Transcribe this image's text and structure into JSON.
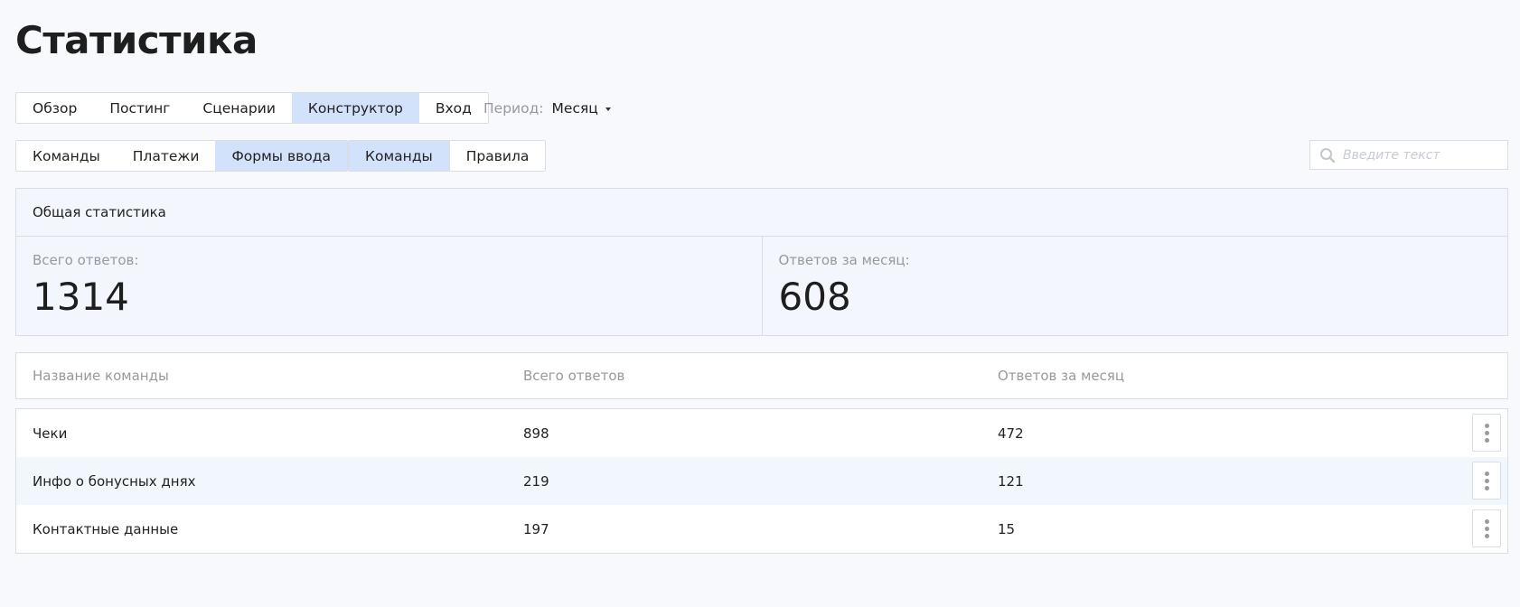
{
  "page": {
    "title": "Статистика"
  },
  "main_tabs": [
    {
      "label": "Обзор",
      "active": false
    },
    {
      "label": "Постинг",
      "active": false
    },
    {
      "label": "Сценарии",
      "active": false
    },
    {
      "label": "Конструктор",
      "active": true
    },
    {
      "label": "Вход",
      "active": false
    }
  ],
  "period": {
    "label": "Период:",
    "value": "Месяц"
  },
  "sub_tabs_1": [
    {
      "label": "Команды",
      "active": false
    },
    {
      "label": "Платежи",
      "active": false
    },
    {
      "label": "Формы ввода",
      "active": true
    }
  ],
  "sub_tabs_2": [
    {
      "label": "Команды",
      "active": true
    },
    {
      "label": "Правила",
      "active": false
    }
  ],
  "search": {
    "placeholder": "Введите текст",
    "value": ""
  },
  "stats": {
    "header": "Общая статистика",
    "total_label": "Всего ответов:",
    "total_value": "1314",
    "month_label": "Ответов за месяц:",
    "month_value": "608"
  },
  "table": {
    "columns": [
      "Название команды",
      "Всего ответов",
      "Ответов за месяц"
    ],
    "rows": [
      [
        "Чеки",
        "898",
        "472"
      ],
      [
        "Инфо о бонусных днях",
        "219",
        "121"
      ],
      [
        "Контактные данные",
        "197",
        "15"
      ]
    ]
  },
  "colors": {
    "background": "#f7f9fd",
    "active_tab": "#d3e2fb",
    "border": "#d9dde4",
    "muted_text": "#999999"
  },
  "icons": {
    "search": "search-icon",
    "more": "more-vertical-icon",
    "caret": "caret-down-icon"
  }
}
